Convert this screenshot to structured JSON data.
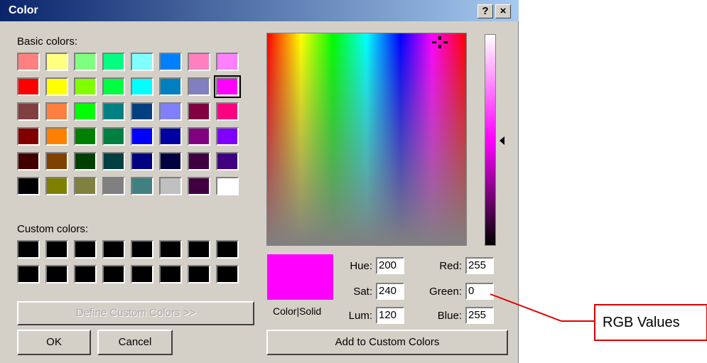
{
  "dialog": {
    "title": "Color",
    "help_label": "?",
    "close_label": "×"
  },
  "basic": {
    "label": "Basic colors:",
    "selected_index": 15,
    "colors": [
      "#ff8080",
      "#ffff80",
      "#80ff80",
      "#00ff80",
      "#80ffff",
      "#0080ff",
      "#ff80c0",
      "#ff80ff",
      "#ff0000",
      "#ffff00",
      "#80ff00",
      "#00ff40",
      "#00ffff",
      "#0080c0",
      "#8080c0",
      "#ff00ff",
      "#804040",
      "#ff8040",
      "#00ff00",
      "#008080",
      "#004080",
      "#8080ff",
      "#800040",
      "#ff0080",
      "#800000",
      "#ff8000",
      "#008000",
      "#008040",
      "#0000ff",
      "#0000a0",
      "#800080",
      "#8000ff",
      "#400000",
      "#804000",
      "#004000",
      "#004040",
      "#000080",
      "#000040",
      "#400040",
      "#400080",
      "#000000",
      "#808000",
      "#808040",
      "#808080",
      "#408080",
      "#c0c0c0",
      "#400040",
      "#ffffff"
    ]
  },
  "custom": {
    "label": "Custom colors:",
    "colors": [
      "#000000",
      "#000000",
      "#000000",
      "#000000",
      "#000000",
      "#000000",
      "#000000",
      "#000000",
      "#000000",
      "#000000",
      "#000000",
      "#000000",
      "#000000",
      "#000000",
      "#000000",
      "#000000"
    ]
  },
  "buttons": {
    "define_custom": "Define Custom Colors >>",
    "ok": "OK",
    "cancel": "Cancel",
    "add_custom": "Add to Custom Colors"
  },
  "preview": {
    "label": "Color|Solid",
    "color": "#ff00ff"
  },
  "fields": {
    "hue": {
      "label": "Hue:",
      "value": "200"
    },
    "sat": {
      "label": "Sat:",
      "value": "240"
    },
    "lum": {
      "label": "Lum:",
      "value": "120"
    },
    "red": {
      "label": "Red:",
      "value": "255"
    },
    "green": {
      "label": "Green:",
      "value": "0"
    },
    "blue": {
      "label": "Blue:",
      "value": "255"
    }
  },
  "annotation": {
    "text": "RGB Values",
    "color": "#e00000"
  }
}
